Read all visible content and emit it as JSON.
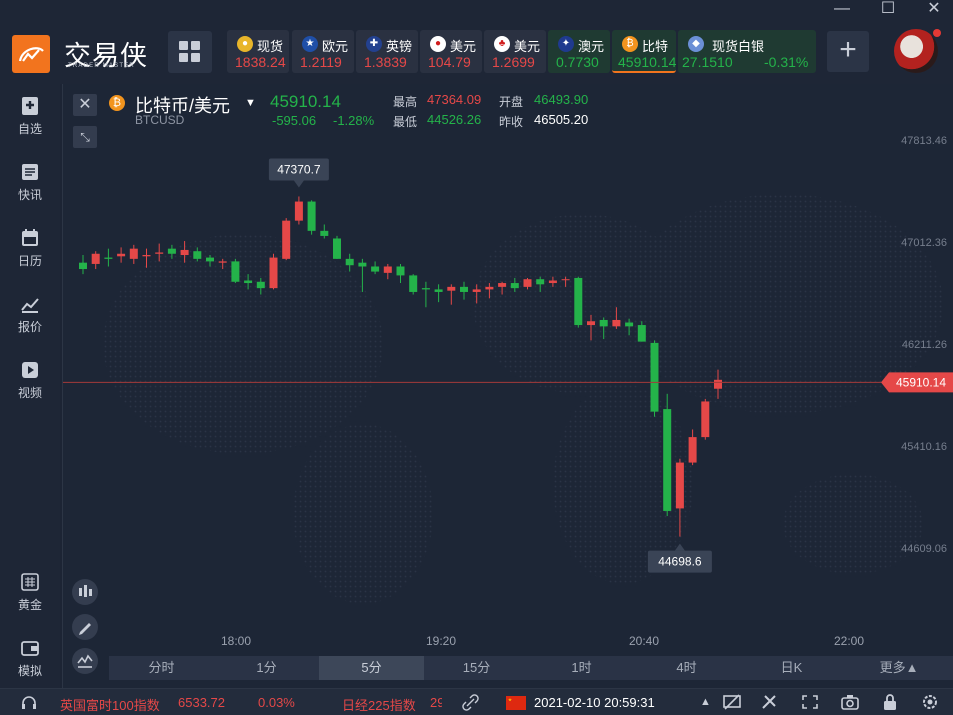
{
  "app": {
    "name": "交易侠",
    "subtitle": "TRADER MASTER"
  },
  "window_controls": {
    "minimize": "—",
    "maximize": "☐",
    "close": "✕"
  },
  "tickers": [
    {
      "name": "现货",
      "price": "1838.24",
      "trend": "up",
      "icon": "gold-icon"
    },
    {
      "name": "欧元",
      "price": "1.2119",
      "trend": "up",
      "icon": "eu-flag-icon"
    },
    {
      "name": "英镑",
      "price": "1.3839",
      "trend": "up",
      "icon": "uk-flag-icon"
    },
    {
      "name": "美元",
      "price": "104.79",
      "trend": "up",
      "icon": "jp-flag-icon"
    },
    {
      "name": "美元",
      "price": "1.2699",
      "trend": "up",
      "icon": "ca-flag-icon"
    },
    {
      "name": "澳元",
      "price": "0.7730",
      "trend": "down",
      "icon": "au-flag-icon"
    },
    {
      "name": "比特",
      "price": "45910.14",
      "trend": "down",
      "icon": "bitcoin-icon"
    },
    {
      "name": "现货白银",
      "price": "27.1510",
      "change": "-0.31%",
      "trend": "down",
      "icon": "silver-icon"
    }
  ],
  "add_label": "+",
  "sidebar": [
    {
      "label": "自选",
      "icon": "watchlist-icon"
    },
    {
      "label": "快讯",
      "icon": "news-icon"
    },
    {
      "label": "日历",
      "icon": "calendar-icon"
    },
    {
      "label": "报价",
      "icon": "quote-chart-icon"
    },
    {
      "label": "视频",
      "icon": "video-icon"
    },
    {
      "label": "黄金",
      "icon": "gold-bars-icon"
    },
    {
      "label": "模拟",
      "icon": "wallet-icon"
    }
  ],
  "symbol": {
    "name": "比特币/美元",
    "code": "BTCUSD",
    "price": "45910.14",
    "change": "-595.06",
    "change_pct": "-1.28%",
    "high_label": "最高",
    "high": "47364.09",
    "open_label": "开盘",
    "open": "46493.90",
    "low_label": "最低",
    "low": "44526.26",
    "prev_label": "昨收",
    "prev_close": "46505.20"
  },
  "colors": {
    "up": "#e54848",
    "down": "#24b34a",
    "accent": "#f2741e"
  },
  "chart_data": {
    "type": "candlestick",
    "y_ticks": [
      "47813.46",
      "47012.36",
      "46211.26",
      "45410.16",
      "44609.06"
    ],
    "x_ticks": [
      "18:00",
      "19:20",
      "20:40",
      "22:00"
    ],
    "last_price_label": "45910.14",
    "high_marker": "47370.7",
    "low_marker": "44698.6",
    "candles": [
      {
        "o": 46850,
        "h": 46910,
        "l": 46760,
        "c": 46800
      },
      {
        "o": 46840,
        "h": 46940,
        "l": 46800,
        "c": 46920
      },
      {
        "o": 46890,
        "h": 46960,
        "l": 46820,
        "c": 46880
      },
      {
        "o": 46900,
        "h": 46970,
        "l": 46850,
        "c": 46920
      },
      {
        "o": 46880,
        "h": 46990,
        "l": 46840,
        "c": 46960
      },
      {
        "o": 46900,
        "h": 46960,
        "l": 46810,
        "c": 46910
      },
      {
        "o": 46920,
        "h": 47000,
        "l": 46860,
        "c": 46930
      },
      {
        "o": 46960,
        "h": 46990,
        "l": 46880,
        "c": 46920
      },
      {
        "o": 46910,
        "h": 47020,
        "l": 46850,
        "c": 46950
      },
      {
        "o": 46940,
        "h": 46970,
        "l": 46860,
        "c": 46880
      },
      {
        "o": 46890,
        "h": 46910,
        "l": 46820,
        "c": 46860
      },
      {
        "o": 46850,
        "h": 46880,
        "l": 46800,
        "c": 46860
      },
      {
        "o": 46860,
        "h": 46880,
        "l": 46690,
        "c": 46700
      },
      {
        "o": 46710,
        "h": 46760,
        "l": 46640,
        "c": 46690
      },
      {
        "o": 46700,
        "h": 46730,
        "l": 46600,
        "c": 46650
      },
      {
        "o": 46650,
        "h": 46920,
        "l": 46640,
        "c": 46890
      },
      {
        "o": 46880,
        "h": 47200,
        "l": 46870,
        "c": 47180
      },
      {
        "o": 47180,
        "h": 47370,
        "l": 47150,
        "c": 47330
      },
      {
        "o": 47330,
        "h": 47340,
        "l": 47070,
        "c": 47100
      },
      {
        "o": 47100,
        "h": 47150,
        "l": 47040,
        "c": 47060
      },
      {
        "o": 47040,
        "h": 47060,
        "l": 46880,
        "c": 46880
      },
      {
        "o": 46880,
        "h": 46920,
        "l": 46780,
        "c": 46830
      },
      {
        "o": 46850,
        "h": 46880,
        "l": 46620,
        "c": 46820
      },
      {
        "o": 46820,
        "h": 46860,
        "l": 46760,
        "c": 46780
      },
      {
        "o": 46770,
        "h": 46840,
        "l": 46720,
        "c": 46820
      },
      {
        "o": 46820,
        "h": 46840,
        "l": 46690,
        "c": 46750
      },
      {
        "o": 46750,
        "h": 46760,
        "l": 46600,
        "c": 46620
      },
      {
        "o": 46650,
        "h": 46700,
        "l": 46500,
        "c": 46640
      },
      {
        "o": 46640,
        "h": 46680,
        "l": 46540,
        "c": 46620
      },
      {
        "o": 46630,
        "h": 46680,
        "l": 46520,
        "c": 46660
      },
      {
        "o": 46660,
        "h": 46700,
        "l": 46560,
        "c": 46620
      },
      {
        "o": 46620,
        "h": 46680,
        "l": 46530,
        "c": 46640
      },
      {
        "o": 46640,
        "h": 46690,
        "l": 46570,
        "c": 46660
      },
      {
        "o": 46660,
        "h": 46700,
        "l": 46600,
        "c": 46690
      },
      {
        "o": 46690,
        "h": 46730,
        "l": 46620,
        "c": 46650
      },
      {
        "o": 46660,
        "h": 46730,
        "l": 46640,
        "c": 46720
      },
      {
        "o": 46720,
        "h": 46740,
        "l": 46620,
        "c": 46680
      },
      {
        "o": 46690,
        "h": 46740,
        "l": 46660,
        "c": 46710
      },
      {
        "o": 46720,
        "h": 46740,
        "l": 46660,
        "c": 46720
      },
      {
        "o": 46730,
        "h": 46740,
        "l": 46340,
        "c": 46360
      },
      {
        "o": 46360,
        "h": 46440,
        "l": 46240,
        "c": 46390
      },
      {
        "o": 46400,
        "h": 46420,
        "l": 46250,
        "c": 46350
      },
      {
        "o": 46350,
        "h": 46500,
        "l": 46330,
        "c": 46400
      },
      {
        "o": 46380,
        "h": 46410,
        "l": 46280,
        "c": 46350
      },
      {
        "o": 46360,
        "h": 46390,
        "l": 46230,
        "c": 46230
      },
      {
        "o": 46220,
        "h": 46240,
        "l": 45640,
        "c": 45680
      },
      {
        "o": 45700,
        "h": 45820,
        "l": 44860,
        "c": 44900
      },
      {
        "o": 44920,
        "h": 45310,
        "l": 44698.6,
        "c": 45280
      },
      {
        "o": 45280,
        "h": 45540,
        "l": 45260,
        "c": 45480
      },
      {
        "o": 45480,
        "h": 45780,
        "l": 45460,
        "c": 45760
      },
      {
        "o": 45860,
        "h": 46010,
        "l": 45780,
        "c": 45930
      }
    ]
  },
  "timeframes": [
    "分时",
    "1分",
    "5分",
    "15分",
    "1时",
    "4时",
    "日K",
    "更多▲"
  ],
  "active_timeframe": "5分",
  "status_bar": {
    "ticker1_name": "英国富时100指数",
    "ticker1_value": "6533.72",
    "ticker1_change": "0.03%",
    "ticker2_name": "日经225指数",
    "ticker2_value": "29",
    "datetime": "2021-02-10 20:59:31"
  }
}
